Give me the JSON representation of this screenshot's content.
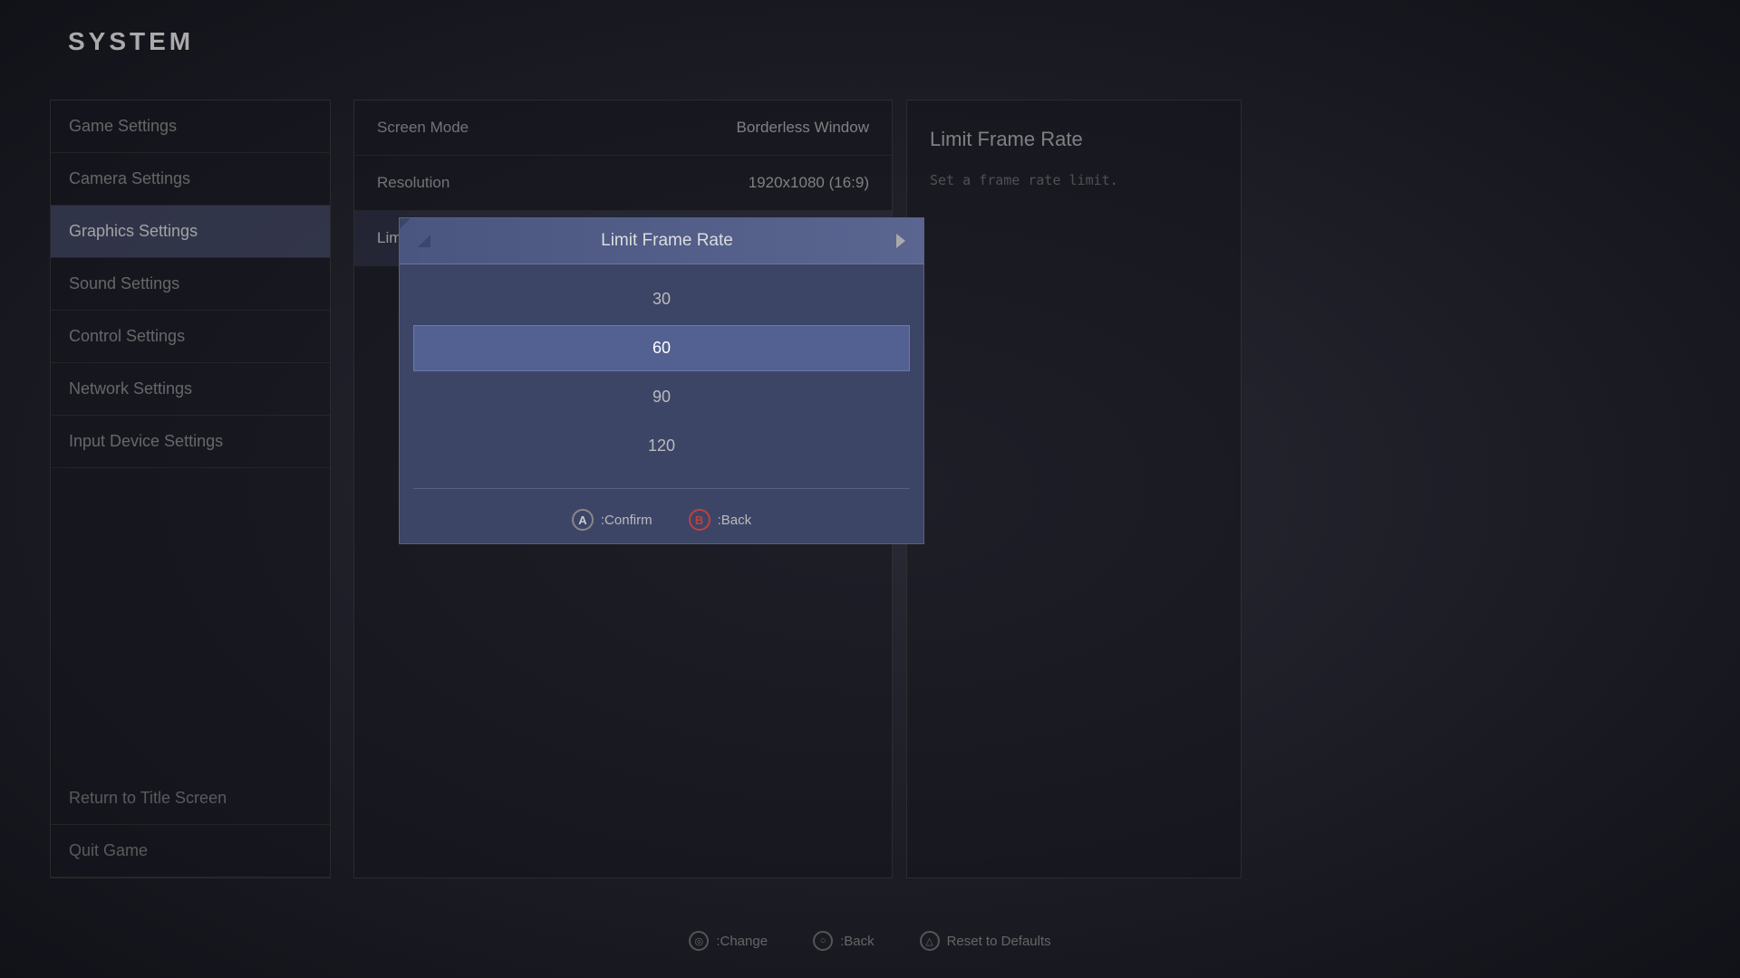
{
  "system": {
    "title": "SYSTEM"
  },
  "menu": {
    "items": [
      {
        "id": "game-settings",
        "label": "Game Settings",
        "active": false
      },
      {
        "id": "camera-settings",
        "label": "Camera Settings",
        "active": false
      },
      {
        "id": "graphics-settings",
        "label": "Graphics Settings",
        "active": true
      },
      {
        "id": "sound-settings",
        "label": "Sound Settings",
        "active": false
      },
      {
        "id": "control-settings",
        "label": "Control Settings",
        "active": false
      },
      {
        "id": "network-settings",
        "label": "Network Settings",
        "active": false
      },
      {
        "id": "input-device-settings",
        "label": "Input Device Settings",
        "active": false
      }
    ],
    "bottom_items": [
      {
        "id": "return-to-title",
        "label": "Return to Title Screen"
      },
      {
        "id": "quit-game",
        "label": "Quit Game"
      }
    ]
  },
  "settings": {
    "rows": [
      {
        "name": "Screen Mode",
        "value": "Borderless Window"
      },
      {
        "name": "Resolution",
        "value": "1920x1080 (16:9)"
      },
      {
        "name": "Limit Frame Rate",
        "value": "60",
        "active": true
      }
    ]
  },
  "help": {
    "title": "Limit Frame Rate",
    "description": "Set a frame rate limit."
  },
  "modal": {
    "title": "Limit Frame Rate",
    "options": [
      {
        "value": "30",
        "selected": false
      },
      {
        "value": "60",
        "selected": true
      },
      {
        "value": "90",
        "selected": false
      },
      {
        "value": "120",
        "selected": false
      }
    ],
    "confirm_label": ":Confirm",
    "back_label": ":Back"
  },
  "bottom_bar": {
    "change_label": ":Change",
    "back_label": ":Back",
    "reset_label": "Reset to Defaults"
  }
}
